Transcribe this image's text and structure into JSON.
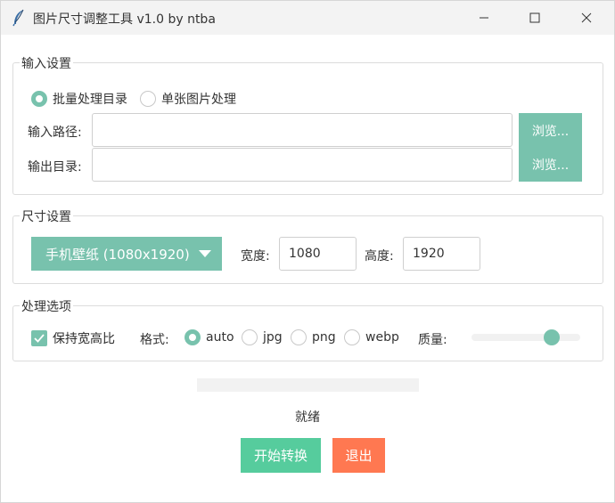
{
  "window": {
    "title": "图片尺寸调整工具 v1.0 by ntba",
    "icon": "feather-icon"
  },
  "colors": {
    "accent": "#78c2ad",
    "start": "#56cc9d",
    "exit": "#ff7851"
  },
  "input_settings": {
    "group_title": "输入设置",
    "mode_options": [
      {
        "label": "批量处理目录",
        "selected": true
      },
      {
        "label": "单张图片处理",
        "selected": false
      }
    ],
    "input_path_label": "输入路径:",
    "input_path_value": "",
    "output_dir_label": "输出目录:",
    "output_dir_value": "",
    "browse_label": "浏览..."
  },
  "size_settings": {
    "group_title": "尺寸设置",
    "preset_selected": "手机壁纸 (1080x1920)",
    "width_label": "宽度:",
    "width_value": "1080",
    "height_label": "高度:",
    "height_value": "1920"
  },
  "processing_options": {
    "group_title": "处理选项",
    "keep_ratio_label": "保持宽高比",
    "keep_ratio_checked": true,
    "format_label": "格式:",
    "formats": [
      {
        "label": "auto",
        "selected": true
      },
      {
        "label": "jpg",
        "selected": false
      },
      {
        "label": "png",
        "selected": false
      },
      {
        "label": "webp",
        "selected": false
      }
    ],
    "quality_label": "质量:",
    "quality_fraction": 0.78
  },
  "progress": {
    "fraction": 0.0
  },
  "status_text": "就绪",
  "actions": {
    "start_label": "开始转换",
    "exit_label": "退出"
  }
}
